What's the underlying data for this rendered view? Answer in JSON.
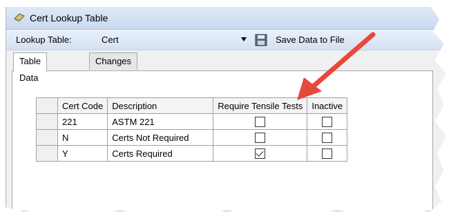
{
  "window": {
    "title": "Cert Lookup Table"
  },
  "toolbar": {
    "lookup_label": "Lookup Table:",
    "lookup_value": "Cert",
    "save_label": "Save Data to File"
  },
  "tabs": [
    {
      "label": "Table Data",
      "active": true
    },
    {
      "label": "Changes",
      "active": false
    }
  ],
  "grid": {
    "columns": [
      "Cert Code",
      "Description",
      "Require Tensile Tests",
      "Inactive"
    ],
    "rows": [
      {
        "code": "221",
        "description": "ASTM 221",
        "require_tensile": false,
        "inactive": false
      },
      {
        "code": "N",
        "description": "Certs Not Required",
        "require_tensile": false,
        "inactive": false
      },
      {
        "code": "Y",
        "description": "Certs Required",
        "require_tensile": true,
        "inactive": false
      }
    ]
  },
  "annotation": {
    "arrow_color": "#e8473c"
  }
}
